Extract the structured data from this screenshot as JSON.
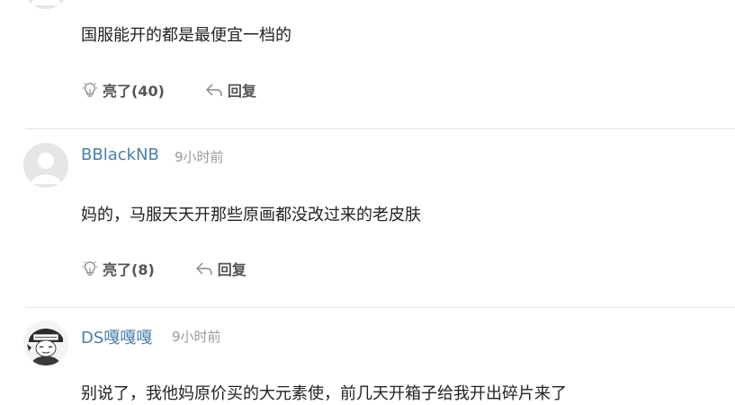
{
  "comments": [
    {
      "content": "国服能开的都是最便宜一档的",
      "likes": "亮了(40)",
      "reply": "回复"
    },
    {
      "username": "BBlackNB",
      "time": "9小时前",
      "content": "妈的，马服天天开那些原画都没改过来的老皮肤",
      "likes": "亮了(8)",
      "reply": "回复",
      "avatar_icon": "default-avatar-icon"
    },
    {
      "username": "DS嘎嘎嘎",
      "time": "9小时前",
      "content": "别说了，我他妈原价买的大元素使，前几天开箱子给我开出碎片来了",
      "avatar_icon": "user-avatar-image"
    }
  ]
}
